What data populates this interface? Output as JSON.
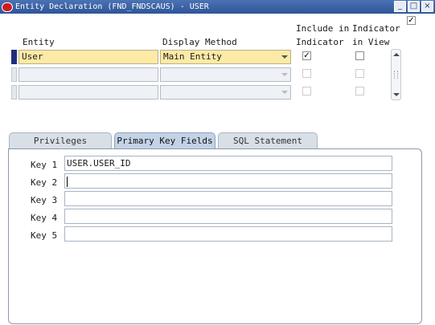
{
  "window": {
    "title": "Entity Declaration (FND_FNDSCAUS) - USER",
    "buttons": {
      "minimize": "_",
      "maximize": "□",
      "close": "×"
    }
  },
  "header_checkbox": {
    "checked": true
  },
  "columns": {
    "entity": "Entity",
    "display_method": "Display Method",
    "include_line1": "Include in",
    "include_line2": "Indicator",
    "indicator_line1": "Indicator",
    "indicator_line2": "in View"
  },
  "rows": [
    {
      "entity": "User",
      "display_method": "Main Entity",
      "include_indicator": true,
      "indicator_in_view": false
    },
    {
      "entity": "",
      "display_method": "",
      "include_indicator": false,
      "indicator_in_view": false
    },
    {
      "entity": "",
      "display_method": "",
      "include_indicator": false,
      "indicator_in_view": false
    }
  ],
  "tabs": [
    {
      "label": "Privileges"
    },
    {
      "label": "Primary Key Fields",
      "active": true
    },
    {
      "label": "SQL Statement"
    }
  ],
  "keys": [
    {
      "label": "Key 1",
      "value": "USER.USER_ID"
    },
    {
      "label": "Key 2",
      "value": ""
    },
    {
      "label": "Key 3",
      "value": ""
    },
    {
      "label": "Key 4",
      "value": ""
    },
    {
      "label": "Key 5",
      "value": ""
    }
  ],
  "check_mark": "✓"
}
